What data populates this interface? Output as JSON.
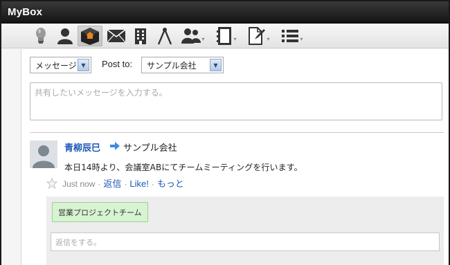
{
  "window": {
    "title": "MyBox"
  },
  "toolbar": {
    "items": [
      {
        "icon": "lightbulb-icon",
        "dropdown": false
      },
      {
        "icon": "user-icon",
        "dropdown": false
      },
      {
        "icon": "mybox-home-icon",
        "dropdown": false,
        "active": true
      },
      {
        "icon": "mail-icon",
        "dropdown": false
      },
      {
        "icon": "building-icon",
        "dropdown": false
      },
      {
        "icon": "compass-icon",
        "dropdown": false
      },
      {
        "icon": "group-icon",
        "dropdown": true
      },
      {
        "icon": "phone-book-icon",
        "dropdown": true
      },
      {
        "icon": "document-pin-icon",
        "dropdown": true
      },
      {
        "icon": "list-icon",
        "dropdown": true
      }
    ],
    "caret": "▾"
  },
  "composer": {
    "type_select": {
      "value": "メッセージ"
    },
    "post_to_label": "Post to:",
    "target_select": {
      "value": "サンプル会社"
    },
    "placeholder": "共有したいメッセージを入力する。",
    "select_arrow": "▼"
  },
  "post": {
    "author": "青柳辰巳",
    "target": "サンプル会社",
    "message": "本日14時より、会議室ABにてチームミーティングを行います。",
    "time": "Just now",
    "actions": {
      "reply": "返信",
      "like": "Like!",
      "more": "もっと"
    },
    "separator": "·",
    "tag": "営業プロジェクトチーム",
    "reply_placeholder": "返信をする。"
  },
  "colors": {
    "link": "#1c58b8",
    "tag_bg": "#d7f3d1",
    "titlebar": "#1f1f1f"
  }
}
